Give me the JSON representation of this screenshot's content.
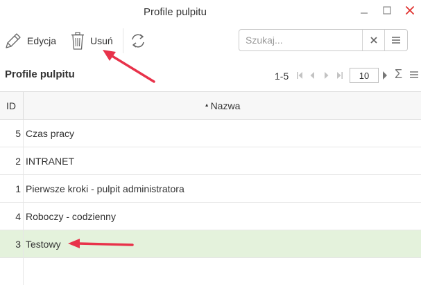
{
  "window": {
    "title": "Profile pulpitu",
    "controls": [
      "minimize-icon",
      "maximize-icon",
      "close-icon"
    ]
  },
  "toolbar": {
    "edit_label": "Edycja",
    "delete_label": "Usuń",
    "refresh_icon": "refresh-icon",
    "search_placeholder": "Szukaj..."
  },
  "grid": {
    "title": "Profile pulpitu",
    "range": "1-5",
    "page_size": "10",
    "columns": {
      "id": "ID",
      "name": "Nazwa"
    },
    "sort": {
      "column": "name",
      "direction": "asc"
    },
    "rows": [
      {
        "id": "5",
        "name": "Czas pracy",
        "selected": false
      },
      {
        "id": "2",
        "name": "INTRANET",
        "selected": false
      },
      {
        "id": "1",
        "name": "Pierwsze kroki - pulpit administratora",
        "selected": false
      },
      {
        "id": "4",
        "name": "Roboczy - codzienny",
        "selected": false
      },
      {
        "id": "3",
        "name": "Testowy",
        "selected": true
      }
    ]
  },
  "colors": {
    "selected_row": "#e4f2dc",
    "close_button": "#e0322f",
    "annotation_arrow": "#e8324a"
  },
  "annotations": [
    {
      "target": "delete-button",
      "type": "arrow"
    },
    {
      "target": "table-row-testowy",
      "type": "arrow"
    }
  ]
}
